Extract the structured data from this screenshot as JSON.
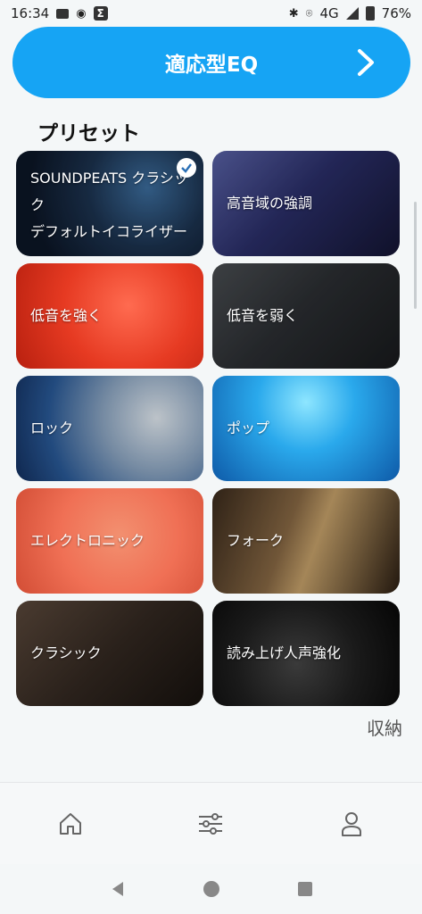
{
  "status_bar": {
    "time": "16:34",
    "network": "4G",
    "battery": "76%"
  },
  "eq_button": {
    "label": "適応型EQ"
  },
  "section_title": "プリセット",
  "presets": [
    {
      "line1": "SOUNDPEATS クラシック",
      "line2": "デフォルトイコライザー",
      "selected": true
    },
    {
      "line1": "高音域の強調"
    },
    {
      "line1": "低音を強く"
    },
    {
      "line1": "低音を弱く"
    },
    {
      "line1": "ロック"
    },
    {
      "line1": "ポップ"
    },
    {
      "line1": "エレクトロニック"
    },
    {
      "line1": "フォーク"
    },
    {
      "line1": "クラシック"
    },
    {
      "line1": "読み上げ人声強化"
    }
  ],
  "collapse_label": "収納",
  "colors": {
    "accent": "#16a4f4",
    "background": "#f4f7f8"
  },
  "bottom_nav": [
    "home-icon",
    "equalizer-sliders-icon",
    "profile-icon"
  ],
  "system_nav": [
    "back-icon",
    "home-circle-icon",
    "recents-icon"
  ]
}
